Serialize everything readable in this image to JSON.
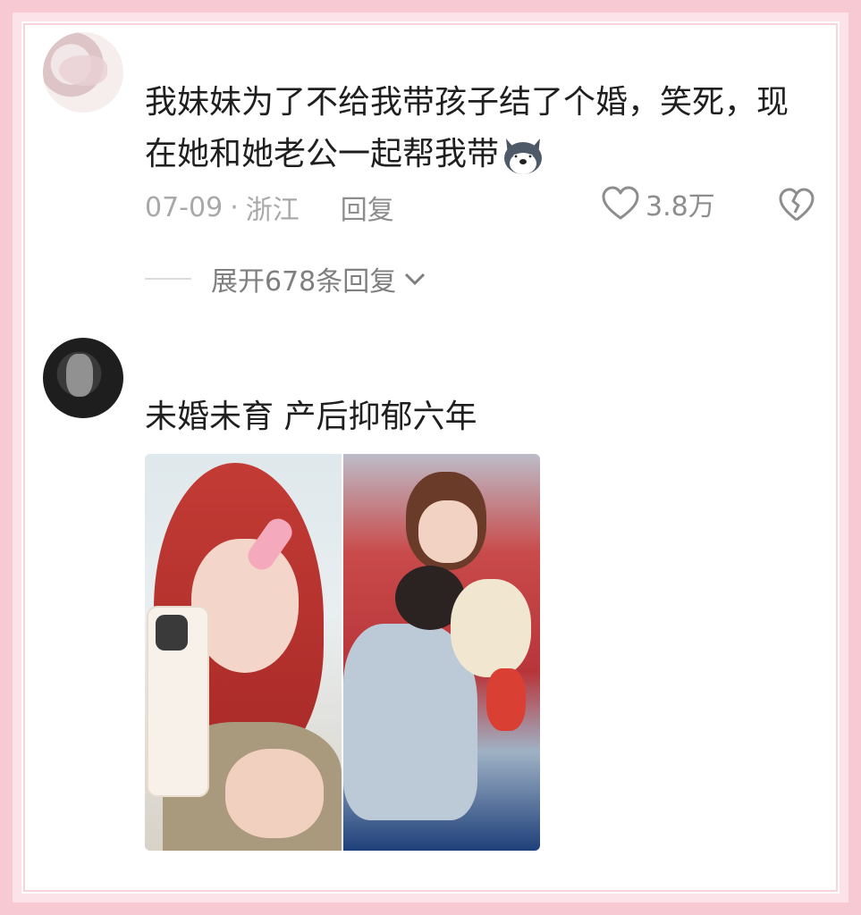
{
  "comments": [
    {
      "text": "我妹妹为了不给我带孩子结了个婚，笑死，现在她和她老公一起帮我带",
      "emoji": "husky-emoji",
      "date": "07-09",
      "separator": "·",
      "location": "浙江",
      "reply_label": "回复",
      "likes": "3.8万",
      "expand_label": "展开678条回复"
    },
    {
      "text": "未婚未育 产后抑郁六年",
      "images": [
        "red-hair-selfie",
        "mother-with-children"
      ]
    }
  ],
  "colors": {
    "frame": "#f6c9d3",
    "text": "#1f1f1f",
    "meta": "#a8a8a8"
  }
}
